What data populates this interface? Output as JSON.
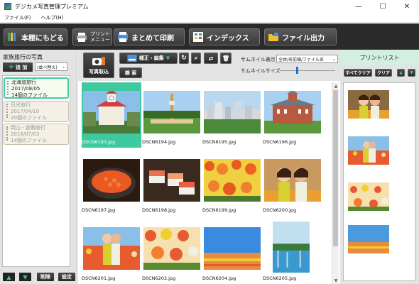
{
  "window": {
    "title": "デジカメ写真管理プレミアム",
    "minimize": "—",
    "maximize": "☐",
    "close": "✕"
  },
  "menu": [
    "ファイル(F)",
    "ヘルプ(H)"
  ],
  "toolbar": {
    "back": "本棚にもどる",
    "print_menu_line1": "プリント",
    "print_menu_line2": "メニュー",
    "batch_print": "まとめて印刷",
    "index": "インデックス",
    "file_output": "ファイル出力"
  },
  "left": {
    "title": "家族旅行の写真",
    "add": "追 加",
    "sort": "(並べ替え)",
    "albums": [
      {
        "name": "北海道旅行",
        "date": "2017/08/05",
        "count": "14個のファイル",
        "selected": true
      },
      {
        "name": "日光旅行",
        "date": "2017/04/10",
        "count": "20個のファイル",
        "selected": false
      },
      {
        "name": "岡山・倉敷旅行",
        "date": "2016/07/03",
        "count": "14個のファイル",
        "selected": false
      }
    ],
    "delete": "削除",
    "settings": "設定"
  },
  "middle": {
    "import": "写真取込",
    "edit": "補正・編集",
    "search": "検 索",
    "thumb_display_label": "サムネイル表示",
    "thumb_display_value": "全体/名前順/ファイル名",
    "thumb_size_label": "サムネイルサイズ",
    "thumb_size_level": 0.3
  },
  "photos": [
    {
      "file": "DSCN6193.jpg",
      "scene": "clocktower",
      "selected": true
    },
    {
      "file": "DSCN6194.jpg",
      "scene": "tower",
      "selected": false
    },
    {
      "file": "DSCN6195.jpg",
      "scene": "city",
      "selected": false
    },
    {
      "file": "DSCN6196.jpg",
      "scene": "redbrick",
      "selected": false
    },
    {
      "file": "DSCN6197.jpg",
      "scene": "ikura",
      "selected": false
    },
    {
      "file": "DSCN6198.jpg",
      "scene": "sushi",
      "selected": false
    },
    {
      "file": "DSCN6199.jpg",
      "scene": "flowers",
      "selected": false
    },
    {
      "file": "DSCN6200.jpg",
      "scene": "women",
      "selected": false
    },
    {
      "file": "DSCN6201.jpg",
      "scene": "women-field",
      "selected": false
    },
    {
      "file": "DSCN6202.jpg",
      "scene": "flowers2",
      "selected": false
    },
    {
      "file": "DSCN6204.jpg",
      "scene": "field",
      "selected": false
    },
    {
      "file": "DSCN6205.jpg",
      "scene": "lake",
      "selected": false
    }
  ],
  "right": {
    "title": "プリントリスト",
    "clear_all": "すべてクリア",
    "clear": "クリア"
  },
  "colors": {
    "accent": "#3ec9a0",
    "toolbar_bg": "#2a2a2a",
    "icon_green": "#3ec67a"
  }
}
